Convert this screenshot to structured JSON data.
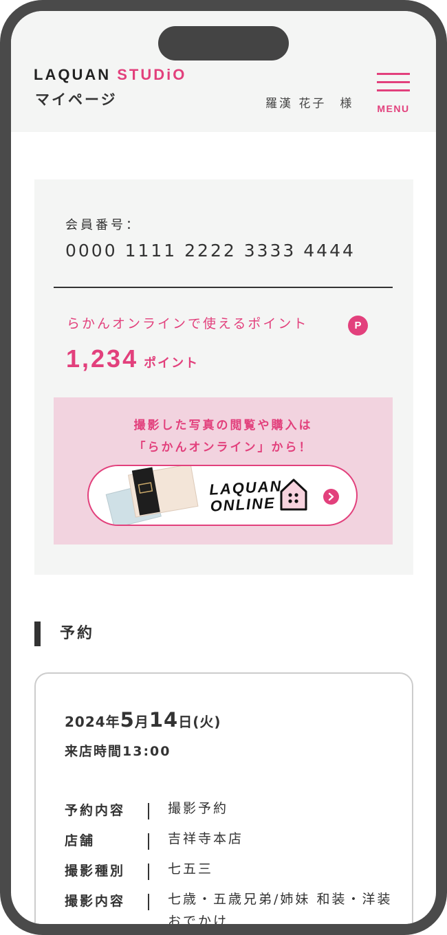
{
  "header": {
    "logo_primary": "LAQUAN",
    "logo_secondary": "STUDiO",
    "page_title": "マイページ",
    "user_name": "羅漢 花子　様",
    "menu_label": "MENU"
  },
  "member": {
    "number_label": "会員番号：",
    "number": "0000 1111 2222 3333 4444",
    "points_label": "らかんオンラインで使えるポイント",
    "points_badge": "P",
    "points_value": "1,234",
    "points_unit": "ポイント"
  },
  "promo": {
    "line1": "撮影した写真の閲覧や購入は",
    "line2": "「らかんオンライン」から！",
    "button_logo_line1": "LAQUAN",
    "button_logo_line2": "ONLINE"
  },
  "reservation": {
    "heading": "予約",
    "date": {
      "year": "2024",
      "year_suffix": "年",
      "month": "5",
      "month_suffix": "月",
      "day": "14",
      "day_suffix": "日",
      "weekday": "(火)"
    },
    "visit_time": "来店時間13:00",
    "details": [
      {
        "label": "予約内容",
        "value": "撮影予約"
      },
      {
        "label": "店舗",
        "value": "吉祥寺本店"
      },
      {
        "label": "撮影種別",
        "value": "七五三"
      },
      {
        "label": "撮影内容",
        "value": "七歳・五歳兄弟/姉妹 和装・洋装おでかけ"
      }
    ]
  },
  "colors": {
    "accent": "#e2407c",
    "panel_bg": "#f4f5f4",
    "promo_bg": "#f2d3df",
    "frame": "#4a4a4a"
  },
  "icons": [
    "hamburger-menu-icon",
    "points-badge-icon",
    "house-icon",
    "chevron-right-icon"
  ]
}
